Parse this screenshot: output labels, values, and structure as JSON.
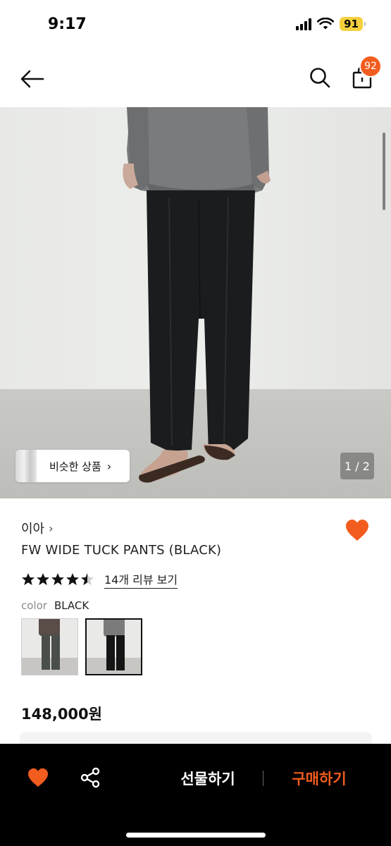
{
  "status_bar": {
    "time": "9:17",
    "battery": "91"
  },
  "header": {
    "cart_count": "92"
  },
  "gallery": {
    "similar_label": "비슷한 상품",
    "similar_chevron": "›",
    "page_counter": "1 / 2"
  },
  "product": {
    "brand": "이아",
    "brand_chevron": "›",
    "title": "FW WIDE TUCK PANTS (BLACK)",
    "rating": 4.5,
    "review_link": "14개 리뷰 보기",
    "color_label": "color",
    "color_value": "BLACK",
    "swatches": [
      "charcoal",
      "black"
    ],
    "price": "148,000원"
  },
  "bottom_bar": {
    "gift_label": "선물하기",
    "buy_label": "구매하기"
  },
  "colors": {
    "accent": "#f25c1e",
    "text": "#111111",
    "bar_bg": "#000000"
  },
  "icons": [
    "back-arrow-icon",
    "search-icon",
    "shopping-bag-icon",
    "heart-icon",
    "share-icon",
    "star-icon"
  ]
}
